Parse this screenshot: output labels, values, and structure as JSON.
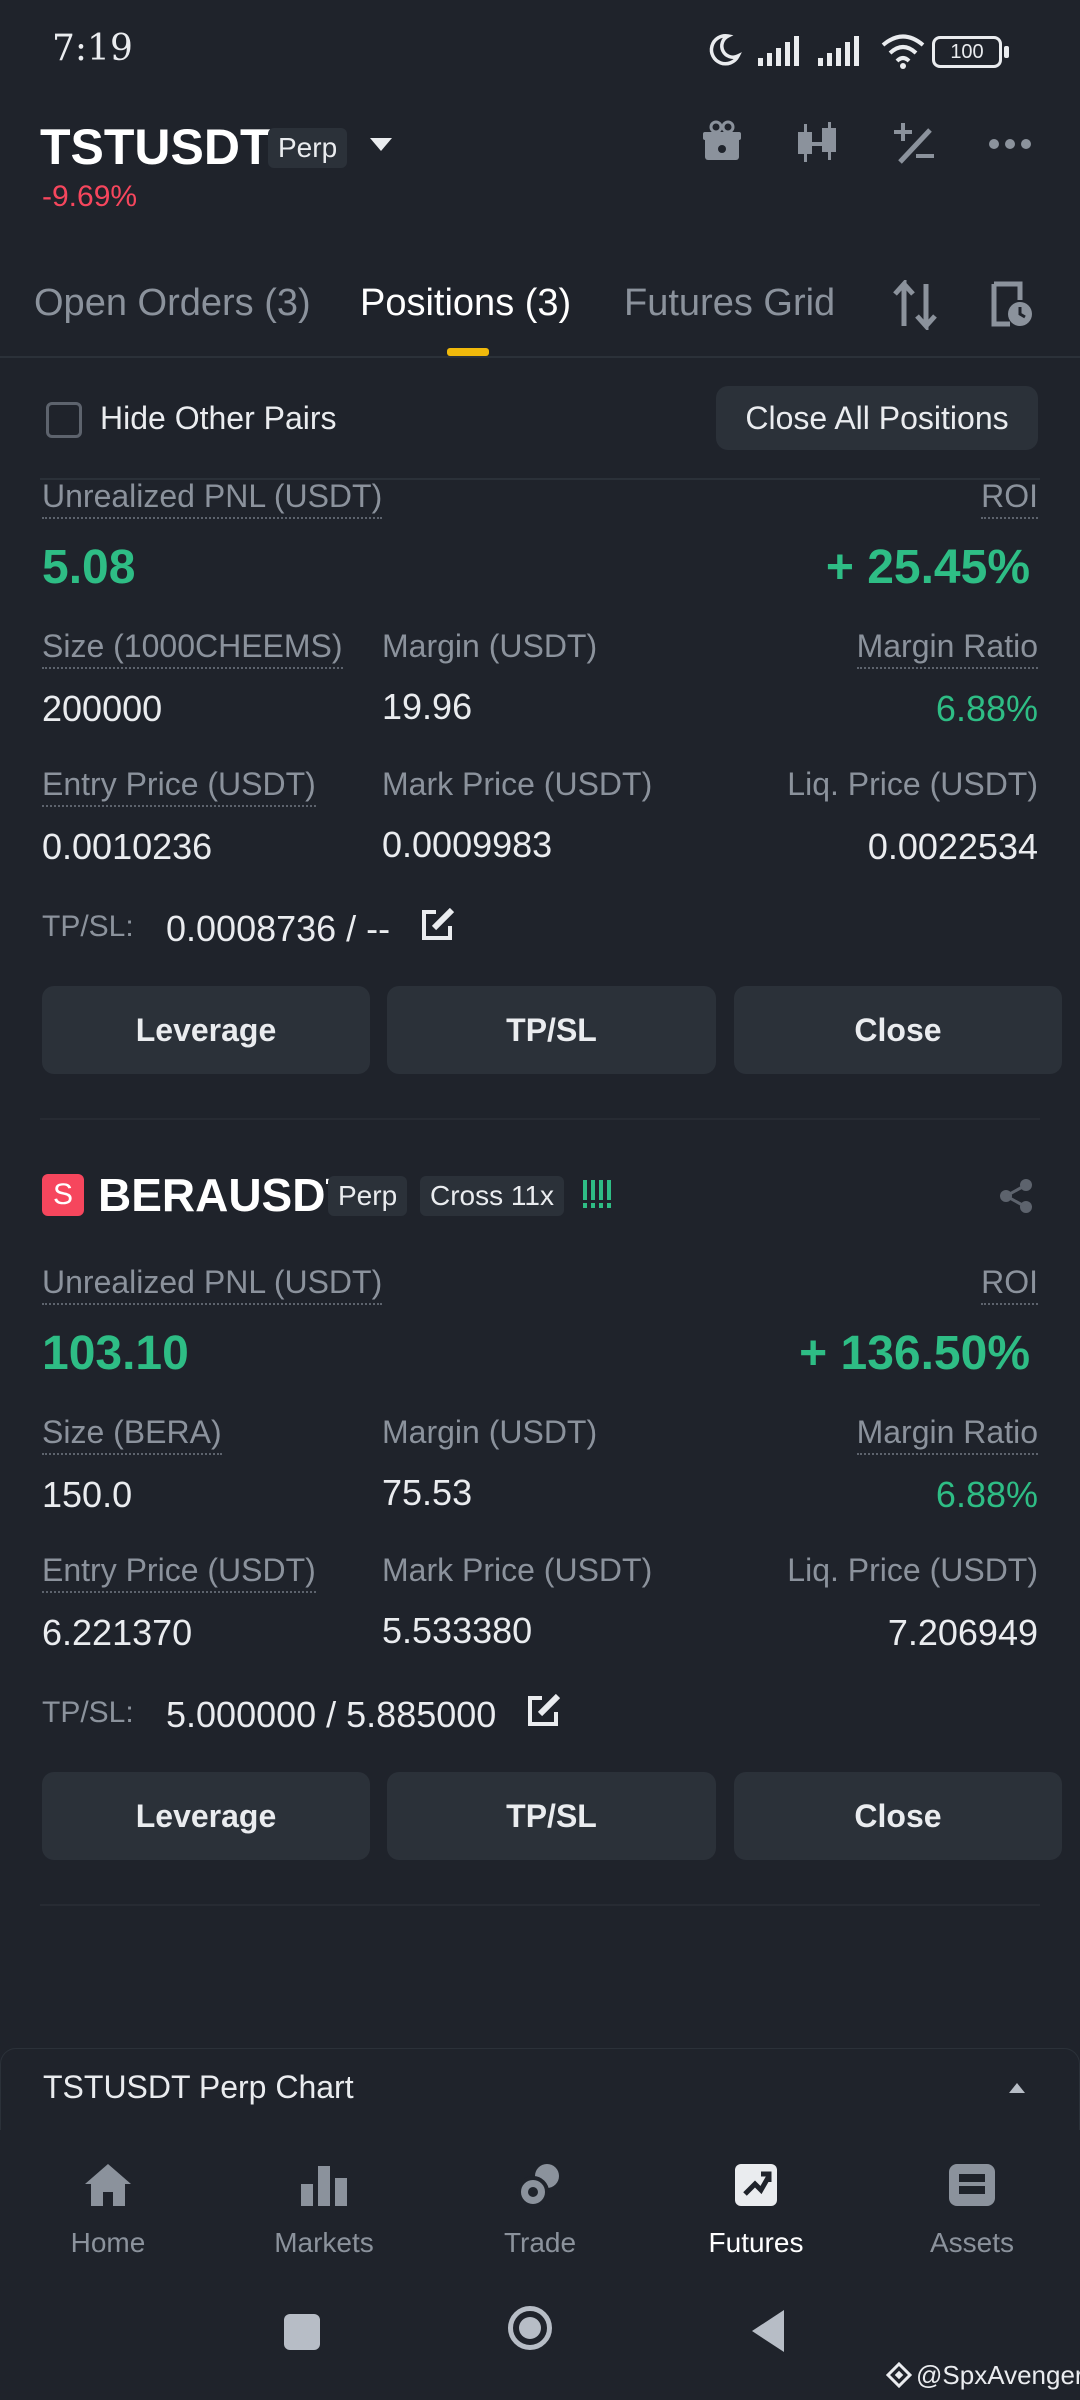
{
  "status": {
    "time": "7:19",
    "battery": "100"
  },
  "header": {
    "symbol": "TSTUSDT",
    "type_chip": "Perp",
    "change": "-9.69%"
  },
  "tabs": {
    "open_orders": "Open Orders (3)",
    "positions": "Positions (3)",
    "futures_grid": "Futures Grid"
  },
  "filter": {
    "hide_other_pairs": "Hide Other Pairs",
    "close_all": "Close All Positions"
  },
  "positions": [
    {
      "pnl_label": "Unrealized PNL (USDT)",
      "pnl": "5.08",
      "roi_label": "ROI",
      "roi": "+ 25.45%",
      "size_label": "Size (1000CHEEMS)",
      "size": "200000",
      "margin_label": "Margin (USDT)",
      "margin": "19.96",
      "margin_ratio_label": "Margin Ratio",
      "margin_ratio": "6.88%",
      "entry_label": "Entry Price (USDT)",
      "entry": "0.0010236",
      "mark_label": "Mark Price (USDT)",
      "mark": "0.0009983",
      "liq_label": "Liq. Price (USDT)",
      "liq": "0.0022534",
      "tpsl_label": "TP/SL:",
      "tpsl": "0.0008736 / --",
      "buttons": {
        "leverage": "Leverage",
        "tpsl": "TP/SL",
        "close": "Close"
      }
    },
    {
      "side": "S",
      "symbol": "BERAUSDT",
      "type_chip": "Perp",
      "mode_chip": "Cross 11x",
      "pnl_label": "Unrealized PNL (USDT)",
      "pnl": "103.10",
      "roi_label": "ROI",
      "roi": "+ 136.50%",
      "size_label": "Size (BERA)",
      "size": "150.0",
      "margin_label": "Margin (USDT)",
      "margin": "75.53",
      "margin_ratio_label": "Margin Ratio",
      "margin_ratio": "6.88%",
      "entry_label": "Entry Price (USDT)",
      "entry": "6.221370",
      "mark_label": "Mark Price (USDT)",
      "mark": "5.533380",
      "liq_label": "Liq. Price (USDT)",
      "liq": "7.206949",
      "tpsl_label": "TP/SL:",
      "tpsl": "5.000000 / 5.885000",
      "buttons": {
        "leverage": "Leverage",
        "tpsl": "TP/SL",
        "close": "Close"
      }
    }
  ],
  "chart_bar": {
    "label": "TSTUSDT Perp Chart"
  },
  "nav": {
    "home": "Home",
    "markets": "Markets",
    "trade": "Trade",
    "futures": "Futures",
    "assets": "Assets"
  },
  "watermark": "@SpxAvenger",
  "colors": {
    "background": "#1f232b",
    "green": "#2ebd85",
    "red": "#f6465d",
    "accent": "#f0b90b",
    "panel": "#2b3139"
  }
}
